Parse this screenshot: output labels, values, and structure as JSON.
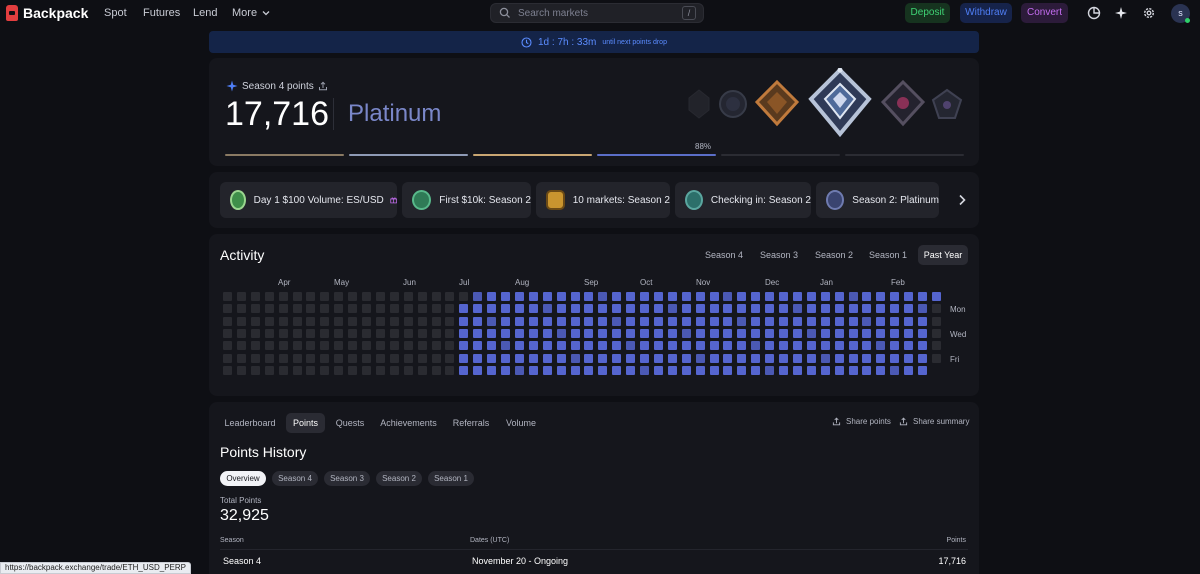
{
  "nav": {
    "brand": "Backpack",
    "links": [
      "Spot",
      "Futures",
      "Lend",
      "More"
    ],
    "search_placeholder": "Search markets",
    "search_shortcut": "/",
    "deposit": "Deposit",
    "withdraw": "Withdraw",
    "convert": "Convert",
    "avatar_initial": "s"
  },
  "banner": {
    "countdown": "1d : 7h : 33m",
    "suffix": "until next points drop"
  },
  "season": {
    "label": "Season 4 points",
    "points": "17,716",
    "tier": "Platinum",
    "progress_percent_label": "88%",
    "progress_fraction": 0.88,
    "segment_colors": [
      "#8a7a63",
      "#8e9ab5",
      "#c9a672",
      "#5b6ec8",
      "#2b2c33",
      "#2b2c33"
    ]
  },
  "achievements": [
    {
      "label": "Day 1 $100 Volume: ES/USD",
      "icon": "dollar-badge-icon",
      "color": "#3f8f4a",
      "extra": "gift-icon"
    },
    {
      "label": "First $10k: Season 2",
      "icon": "10k-badge-icon",
      "color": "#2f7a56"
    },
    {
      "label": "10 markets: Season 2",
      "icon": "coin-stack-icon",
      "color": "#c9952f"
    },
    {
      "label": "Checking in: Season 2",
      "icon": "calendar-20-icon",
      "color": "#2c6f6a"
    },
    {
      "label": "Season 2: Platinum",
      "icon": "platinum-badge-icon",
      "color": "#3a4470"
    }
  ],
  "activity": {
    "title": "Activity",
    "tabs": [
      "Season 4",
      "Season 3",
      "Season 2",
      "Season 1",
      "Past Year"
    ],
    "active_tab": "Past Year",
    "months": [
      "Apr",
      "May",
      "Jun",
      "Jul",
      "Aug",
      "Sep",
      "Oct",
      "Nov",
      "Dec",
      "Jan",
      "Feb"
    ],
    "weekday_labels": [
      "Mon",
      "Wed",
      "Fri"
    ],
    "active_color": "#5565cf",
    "inactive_color": "#2a2b31"
  },
  "points_section": {
    "tabs": [
      "Leaderboard",
      "Points",
      "Quests",
      "Achievements",
      "Referrals",
      "Volume"
    ],
    "active_tab": "Points",
    "share_points": "Share points",
    "share_summary": "Share summary",
    "history_title": "Points History",
    "filters": [
      "Overview",
      "Season 4",
      "Season 3",
      "Season 2",
      "Season 1"
    ],
    "active_filter": "Overview",
    "total_label": "Total Points",
    "total_value": "32,925",
    "columns": [
      "Season",
      "Dates (UTC)",
      "Points"
    ],
    "rows": [
      {
        "season": "Season 4",
        "dates": "November 20 - Ongoing",
        "points": "17,716"
      }
    ]
  },
  "status_url": "https://backpack.exchange/trade/ETH_USD_PERP"
}
